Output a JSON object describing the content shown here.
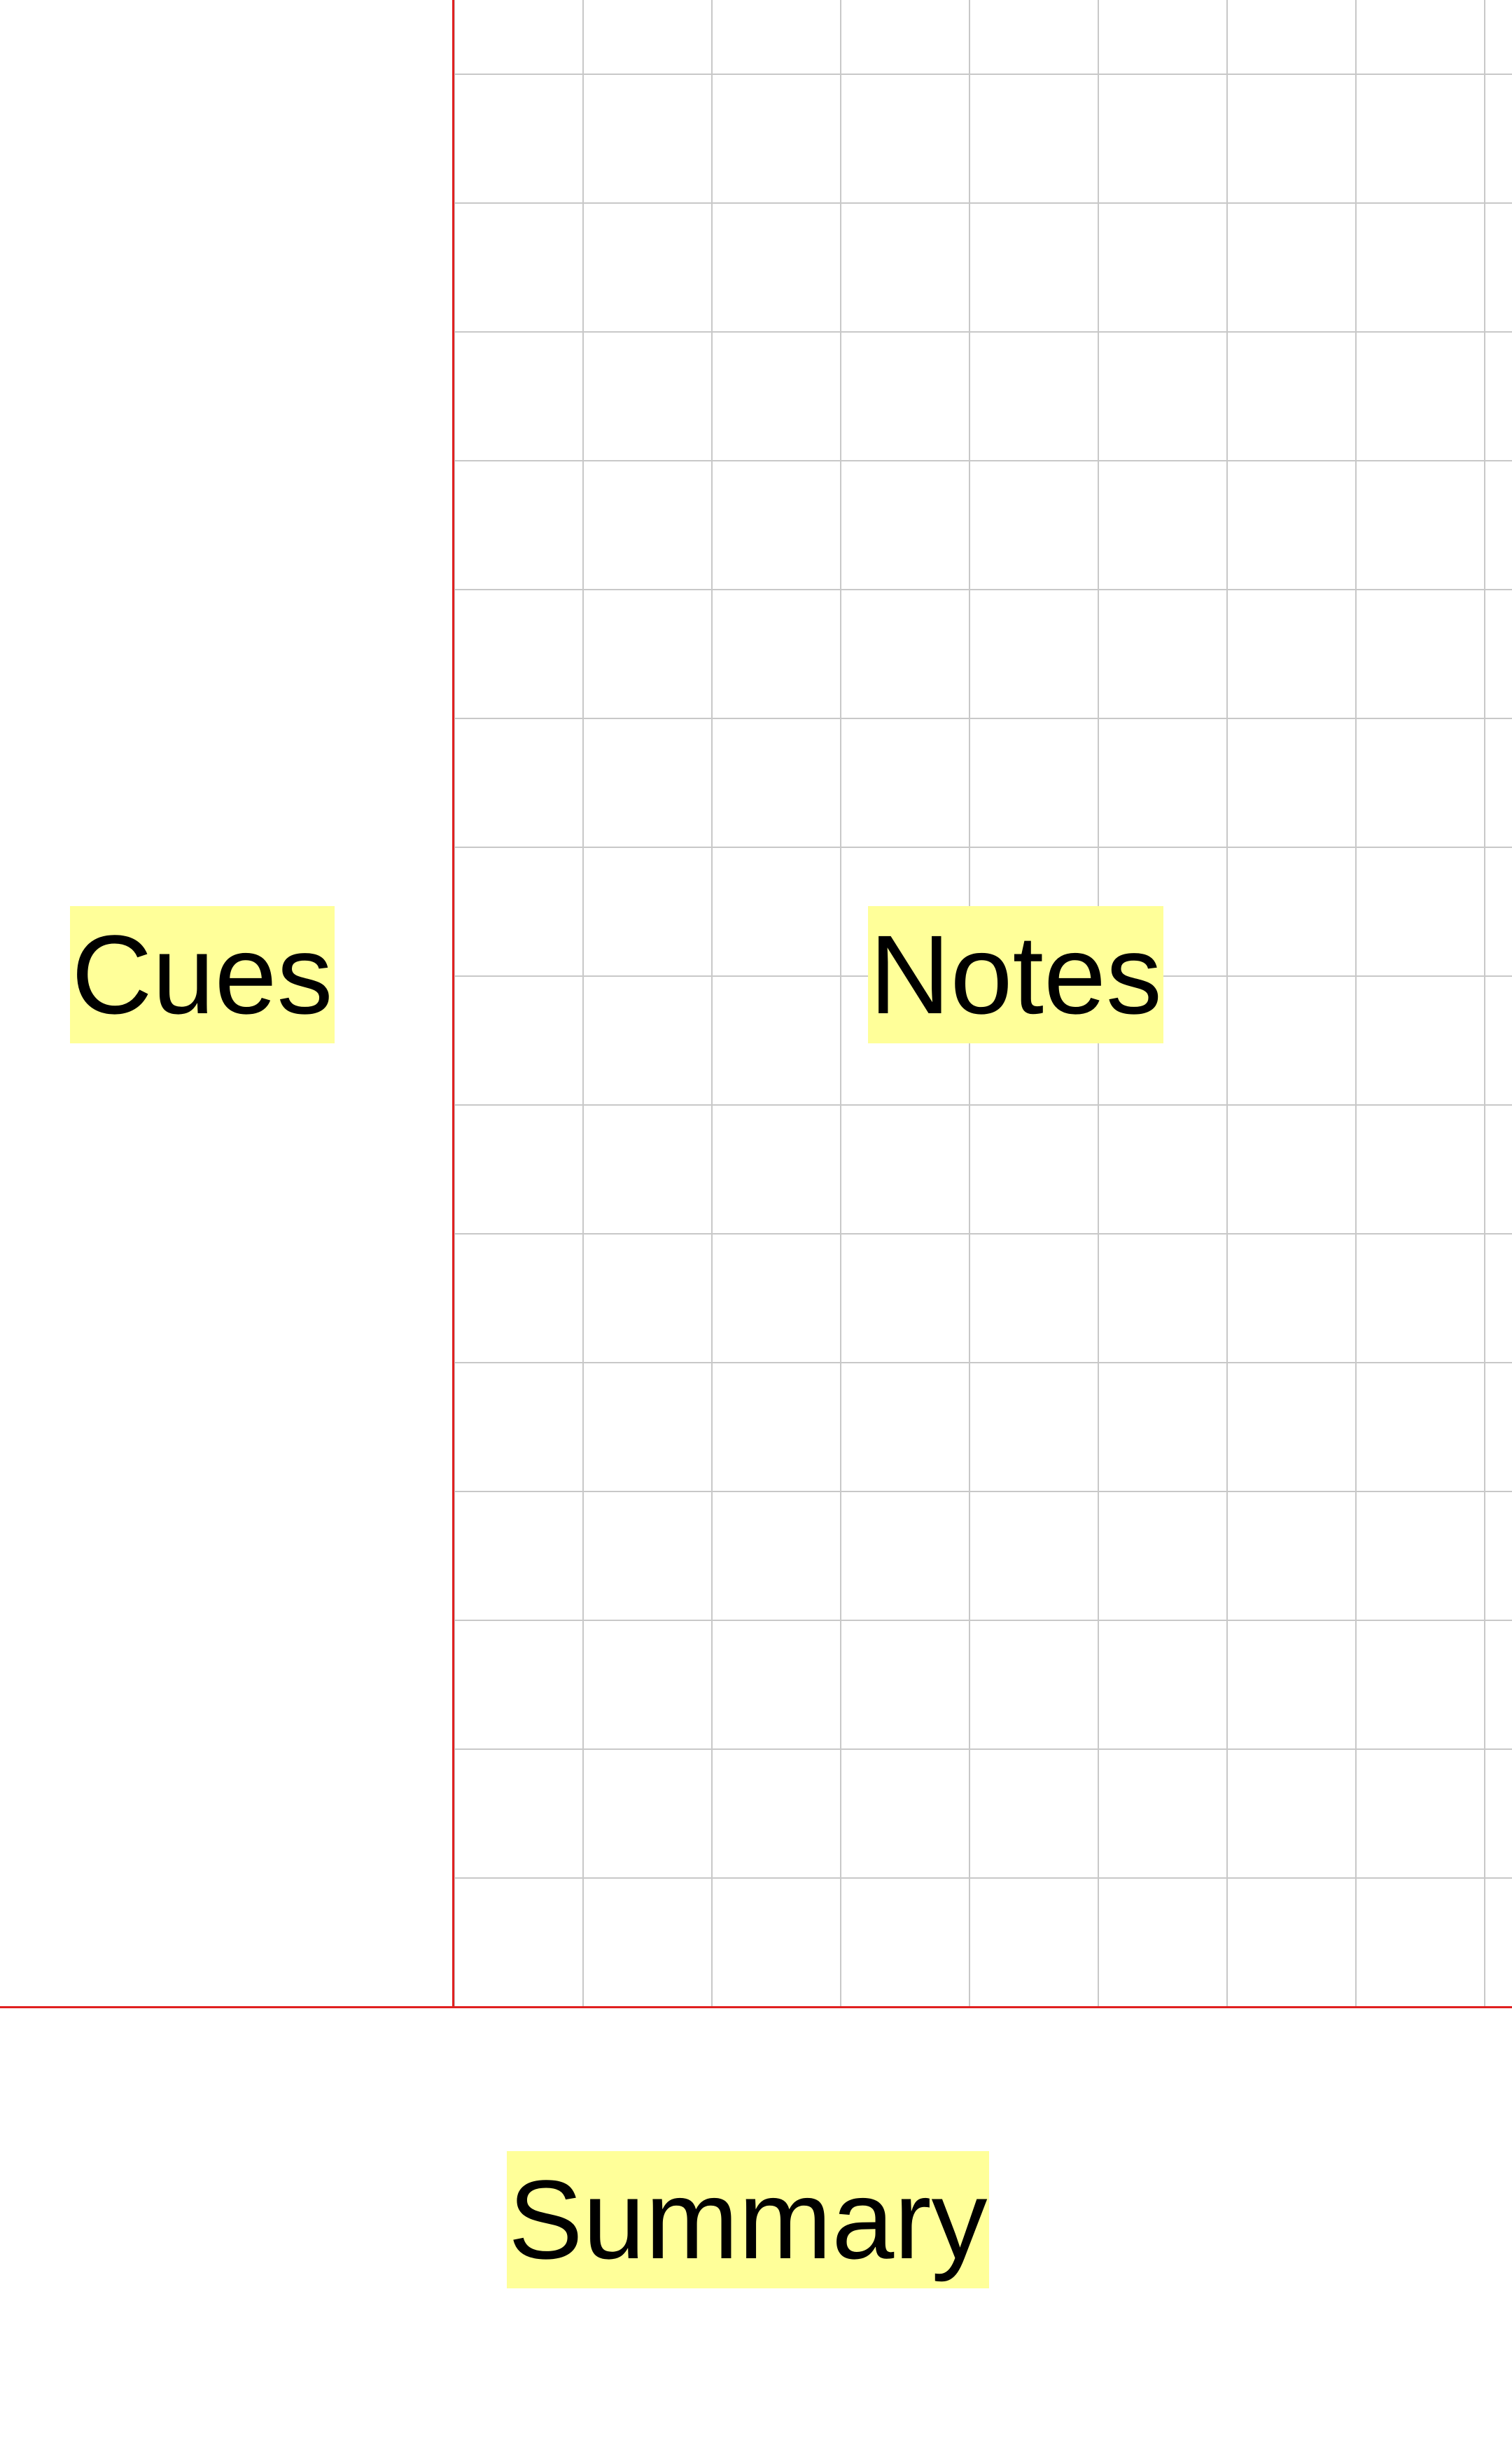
{
  "colors": {
    "background": "#ffffff",
    "grid_line": "#c8c8c8",
    "divider": "#e02020",
    "label_highlight": "#ffff99",
    "text": "#000000"
  },
  "sections": {
    "cues": {
      "label": "Cues"
    },
    "notes": {
      "label": "Notes"
    },
    "summary": {
      "label": "Summary"
    }
  }
}
